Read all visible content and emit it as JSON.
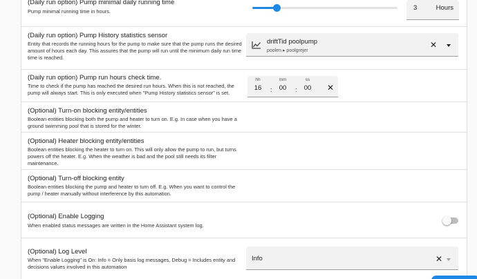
{
  "rows": {
    "min_runtime": {
      "title": "(Daily run option) Pump minimal daily running time",
      "desc": "Pump minimal running time in hours.",
      "value": "3",
      "unit": "Hours",
      "slider_fraction": 0.17
    },
    "history_sensor": {
      "title": "(Daily run option) Pump History statistics sensor",
      "desc": "Entity that records the running hours for the pump to make sure that the pump runs the desired amount of hours each day. This assures that the pump will run until the minimum daily run time time is reached.",
      "entity_name": "driftTid poolpump",
      "entity_path": "poolen ▸ poolgrejer",
      "icon": "chart-line-icon"
    },
    "check_time": {
      "title": "(Daily run option) Pump run hours check time.",
      "desc": "Time to check if the pump has reached the desired run hours. When this is not reached, the pump will always start. This is only executed when \"Pump History statistics sensor\" is set.",
      "hh_label": "hh",
      "mm_label": "mm",
      "ss_label": "ss",
      "hh": "16",
      "mm": "00",
      "ss": "00"
    },
    "turn_on_blocking": {
      "title": "(Optional) Turn-on blocking entity/entities",
      "desc": "Boolean entities blocking both the pump and heater to turn on. E.g. In case when you have a ground swimming pool that is stored for the winter."
    },
    "heater_blocking": {
      "title": "(Optional) Heater blocking entity/entities",
      "desc": "Boolean entities blocking the heater to turn on. This will only allow the pump to run, but turns powers off the heater. E.g. When the weather is bad and the pool still needs its filter maintenance."
    },
    "turn_off_blocking": {
      "title": "(Optional) Turn-off blocking entity",
      "desc": "Boolean entities blocking the pump and heater to turn off. E.g. When you want to control the pump / heater manually without interference by this automation."
    },
    "logging": {
      "title": "(Optional) Enable Logging",
      "desc": "When enabled status messages are written in the Home Assistant system log.",
      "enabled": false
    },
    "log_level": {
      "title": "(Optional) Log Level",
      "desc": "When \"Enable Logging\" is On: Info = Only basis log messages, Debug = Includes entity and decisions values involved in this automation",
      "value": "Info"
    }
  },
  "colors": {
    "accent": "#1e88e5",
    "divider": "#e0e0e0",
    "field_bg": "#f2f2f2"
  }
}
